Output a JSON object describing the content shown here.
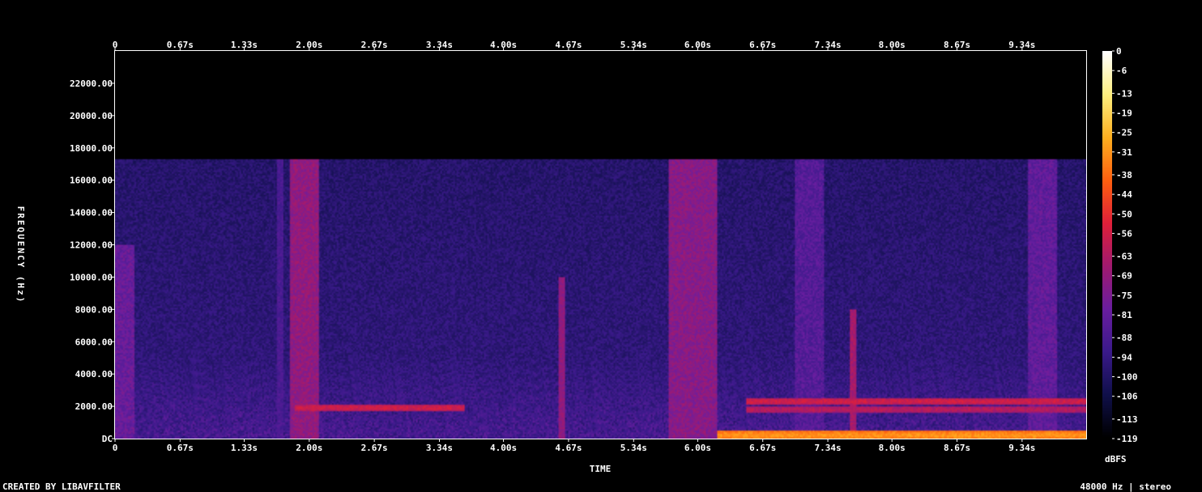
{
  "chart_data": {
    "type": "heatmap",
    "subtype": "spectrogram",
    "xlabel": "TIME",
    "ylabel": "FREQUENCY (Hz)",
    "x_tick_labels": [
      "0",
      "0.67s",
      "1.33s",
      "2.00s",
      "2.67s",
      "3.34s",
      "4.00s",
      "4.67s",
      "5.34s",
      "6.00s",
      "6.67s",
      "7.34s",
      "8.00s",
      "8.67s",
      "9.34s"
    ],
    "x_tick_values_s": [
      0,
      0.67,
      1.33,
      2.0,
      2.67,
      3.34,
      4.0,
      4.67,
      5.34,
      6.0,
      6.67,
      7.34,
      8.0,
      8.67,
      9.34
    ],
    "x_range_s": [
      0,
      10.0
    ],
    "y_tick_labels": [
      "DC",
      "2000.00",
      "4000.00",
      "6000.00",
      "8000.00",
      "10000.00",
      "12000.00",
      "14000.00",
      "16000.00",
      "18000.00",
      "20000.00",
      "22000.00"
    ],
    "y_tick_values_hz": [
      0,
      2000,
      4000,
      6000,
      8000,
      10000,
      12000,
      14000,
      16000,
      18000,
      20000,
      22000
    ],
    "y_range_hz": [
      0,
      24000
    ],
    "colorbar": {
      "unit": "dBFS",
      "tick_labels": [
        "0",
        "-6",
        "-13",
        "-19",
        "-25",
        "-31",
        "-38",
        "-44",
        "-50",
        "-56",
        "-63",
        "-69",
        "-75",
        "-81",
        "-88",
        "-94",
        "-100",
        "-106",
        "-113",
        "-119"
      ],
      "range_db": [
        -119,
        0
      ],
      "colormap": "intensity (black-navy-purple-red-orange-yellow-white)",
      "stops": [
        "#000000",
        "#10104a",
        "#3a1a8a",
        "#6a1ea0",
        "#a01a70",
        "#e0203a",
        "#ff6010",
        "#ffb020",
        "#fff080",
        "#ffffff"
      ]
    },
    "content_cutoff_hz": 17300,
    "background_level_db": -95,
    "notable_features": [
      {
        "kind": "band",
        "t_start_s": 0.0,
        "t_end_s": 0.2,
        "f_max_hz": 12000,
        "level_db": -80
      },
      {
        "kind": "band",
        "t_start_s": 1.8,
        "t_end_s": 2.1,
        "f_max_hz": 17300,
        "level_db": -70
      },
      {
        "kind": "band",
        "t_start_s": 5.7,
        "t_end_s": 6.2,
        "f_max_hz": 17300,
        "level_db": -72
      },
      {
        "kind": "band",
        "t_start_s": 7.0,
        "t_end_s": 7.3,
        "f_max_hz": 17300,
        "level_db": -85
      },
      {
        "kind": "band",
        "t_start_s": 9.4,
        "t_end_s": 9.7,
        "f_max_hz": 17300,
        "level_db": -82
      },
      {
        "kind": "harmonic",
        "t_start_s": 1.85,
        "t_end_s": 3.6,
        "f_hz": 1900,
        "level_db": -55
      },
      {
        "kind": "harmonic",
        "t_start_s": 6.5,
        "t_end_s": 10.0,
        "f_hz": 2300,
        "level_db": -55
      },
      {
        "kind": "harmonic",
        "t_start_s": 6.5,
        "t_end_s": 10.0,
        "f_hz": 1800,
        "level_db": -60
      },
      {
        "kind": "low",
        "t_start_s": 6.2,
        "t_end_s": 10.0,
        "f_hz": 200,
        "level_db": -30
      },
      {
        "kind": "transient",
        "t_s": 4.6,
        "f_max_hz": 10000,
        "level_db": -70
      },
      {
        "kind": "transient",
        "t_s": 7.6,
        "f_max_hz": 8000,
        "level_db": -65
      },
      {
        "kind": "transient",
        "t_s": 1.7,
        "f_max_hz": 18000,
        "level_db": -88
      }
    ]
  },
  "footer": {
    "credit": "CREATED BY LIBAVFILTER",
    "format": "48000 Hz | stereo"
  }
}
